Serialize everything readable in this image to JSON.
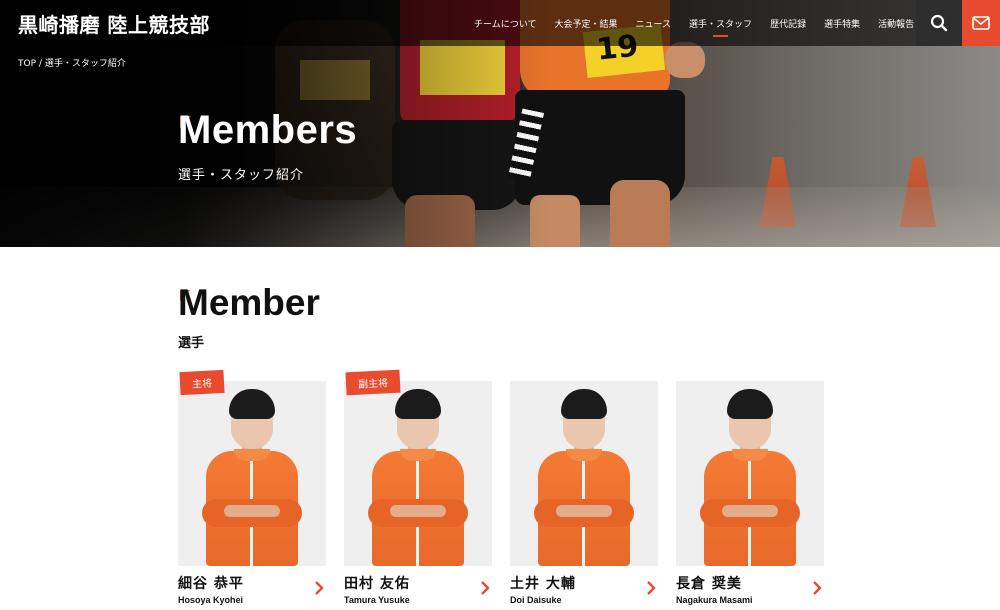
{
  "header": {
    "logo": "黒崎播磨 陸上競技部",
    "nav": [
      {
        "label": "チームについて",
        "active": false
      },
      {
        "label": "大会予定・結果",
        "active": false
      },
      {
        "label": "ニュース",
        "active": false
      },
      {
        "label": "選手・スタッフ",
        "active": true
      },
      {
        "label": "歴代記録",
        "active": false
      },
      {
        "label": "選手特集",
        "active": false
      },
      {
        "label": "活動報告",
        "active": false
      }
    ],
    "search_icon": "search-icon",
    "mail_icon": "mail-icon"
  },
  "breadcrumb": {
    "home": "TOP",
    "separator": "/",
    "current": "選手・スタッフ紹介"
  },
  "hero": {
    "title": "Members",
    "subtitle": "選手・スタッフ紹介",
    "bib_number": "19"
  },
  "section": {
    "title": "Member",
    "subtitle": "選手"
  },
  "members": [
    {
      "name_jp": "細谷 恭平",
      "name_en": "Hosoya Kyohei",
      "tag": "主将"
    },
    {
      "name_jp": "田村 友佑",
      "name_en": "Tamura Yusuke",
      "tag": "副主将"
    },
    {
      "name_jp": "土井 大輔",
      "name_en": "Doi Daisuke",
      "tag": ""
    },
    {
      "name_jp": "長倉 奨美",
      "name_en": "Nagakura Masami",
      "tag": ""
    }
  ],
  "colors": {
    "accent": "#e84b2e",
    "jacket": "#f47a34",
    "text": "#111111"
  }
}
